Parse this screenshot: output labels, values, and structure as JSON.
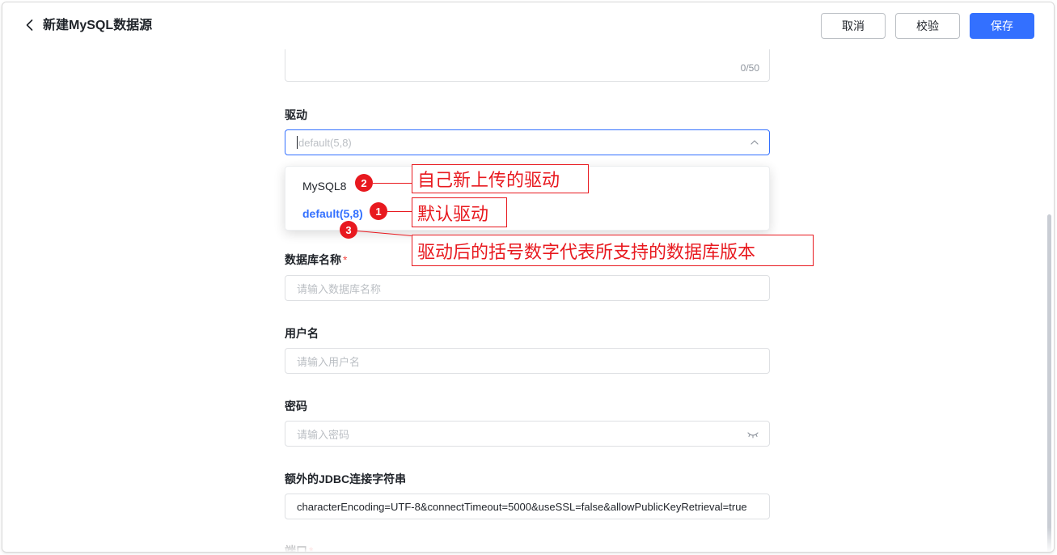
{
  "header": {
    "title": "新建MySQL数据源",
    "buttons": {
      "cancel": "取消",
      "validate": "校验",
      "save": "保存"
    }
  },
  "description": {
    "counter": "0/50"
  },
  "driver": {
    "label": "驱动",
    "value": "default(5,8)",
    "options": [
      {
        "label": "MySQL8",
        "selected": false
      },
      {
        "label": "default(5,8)",
        "selected": true
      }
    ]
  },
  "database": {
    "label": "数据库名称",
    "required_mark": "*",
    "placeholder": "请输入数据库名称"
  },
  "username": {
    "label": "用户名",
    "placeholder": "请输入用户名"
  },
  "password": {
    "label": "密码",
    "placeholder": "请输入密码"
  },
  "jdbc": {
    "label": "额外的JDBC连接字符串",
    "value": "characterEncoding=UTF-8&connectTimeout=5000&useSSL=false&allowPublicKeyRetrieval=true"
  },
  "port": {
    "label": "端口",
    "required_mark": "*"
  },
  "annotations": [
    {
      "number": "2",
      "text": "自己新上传的驱动"
    },
    {
      "number": "1",
      "text": "默认驱动"
    },
    {
      "number": "3",
      "text": "驱动后的括号数字代表所支持的数据库版本"
    }
  ],
  "colors": {
    "primary": "#3370ff",
    "annotation_red": "#e8191f",
    "required": "#f54a45"
  }
}
